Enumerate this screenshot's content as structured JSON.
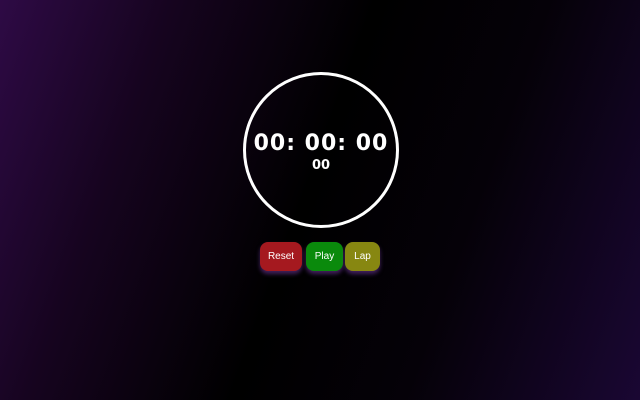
{
  "stopwatch": {
    "time_main": "00: 00: 00",
    "time_ms": "00"
  },
  "controls": {
    "reset_label": "Reset",
    "play_label": "Play",
    "lap_label": "Lap"
  },
  "colors": {
    "reset": "#a5191f",
    "play": "#0a8a0c",
    "lap": "#878711",
    "dial_border": "#ffffff",
    "background_accent": "#2e0a45"
  }
}
